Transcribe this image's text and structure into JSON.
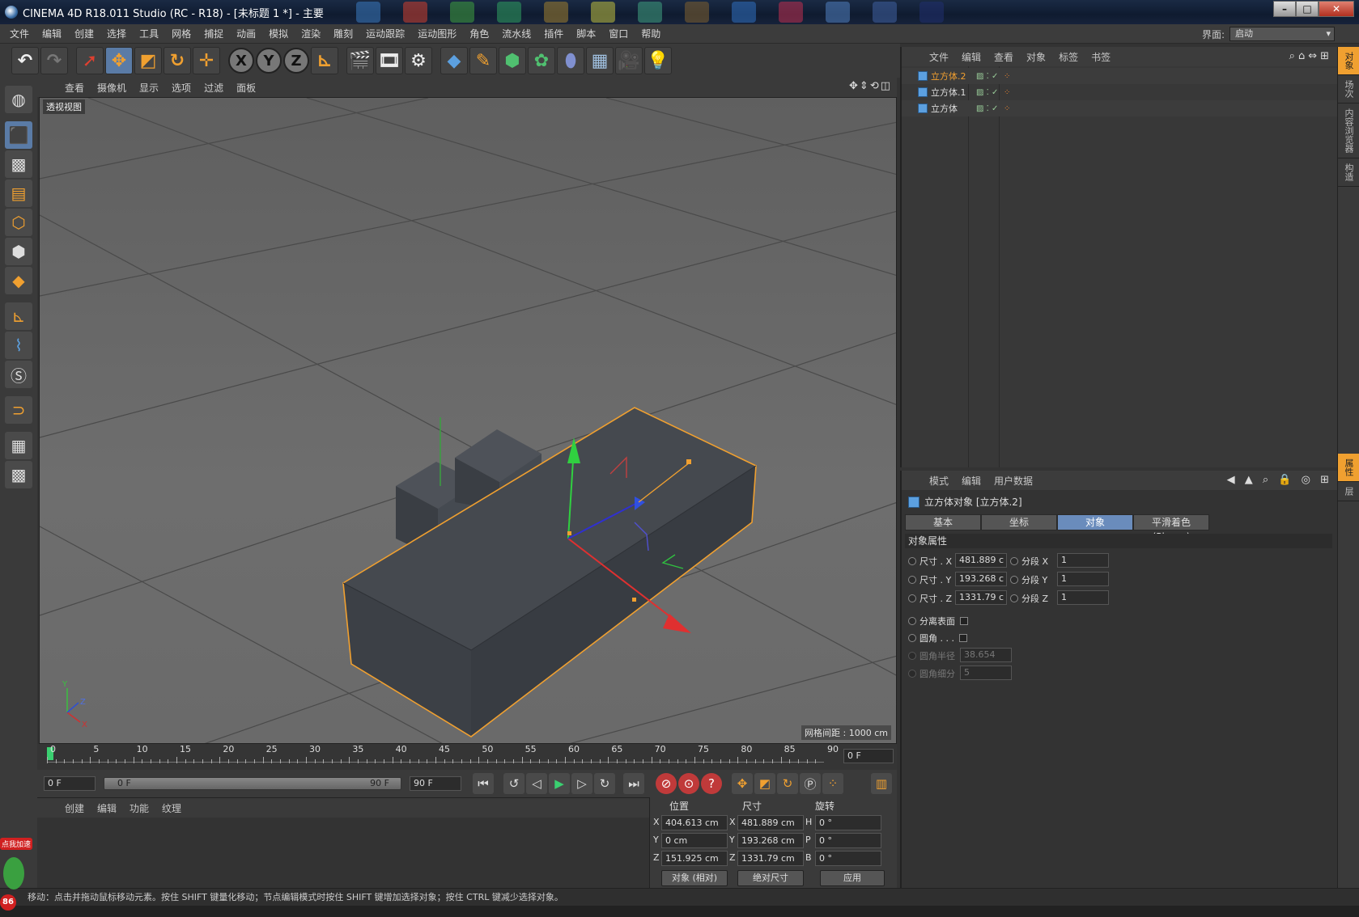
{
  "window": {
    "title": "CINEMA 4D R18.011 Studio (RC - R18) - [未标题 1 *] - 主要"
  },
  "menubar": {
    "items": [
      "文件",
      "编辑",
      "创建",
      "选择",
      "工具",
      "网格",
      "捕捉",
      "动画",
      "模拟",
      "渲染",
      "雕刻",
      "运动跟踪",
      "运动图形",
      "角色",
      "流水线",
      "插件",
      "脚本",
      "窗口",
      "帮助"
    ],
    "interface_label": "界面:",
    "interface_value": "启动"
  },
  "viewport": {
    "menu": [
      "查看",
      "摄像机",
      "显示",
      "选项",
      "过滤",
      "面板"
    ],
    "view_label": "透视视图",
    "grid_spacing": "网格间距 : 1000 cm",
    "axis_labels": {
      "y": "Y",
      "z": "Z",
      "x": "X"
    }
  },
  "timeline": {
    "ticks": [
      "0",
      "5",
      "10",
      "15",
      "20",
      "25",
      "30",
      "35",
      "40",
      "45",
      "50",
      "55",
      "60",
      "65",
      "70",
      "75",
      "80",
      "85",
      "90"
    ],
    "current_frame": "0 F"
  },
  "transport": {
    "start_field": "0 F",
    "range_start": "0 F",
    "range_end": "90 F",
    "end_field": "90 F"
  },
  "material_manager": {
    "menu": [
      "创建",
      "编辑",
      "功能",
      "纹理"
    ]
  },
  "coordinates": {
    "headers": {
      "position": "位置",
      "size": "尺寸",
      "rotation": "旋转"
    },
    "rows": [
      {
        "axis": "X",
        "pos": "404.613 cm",
        "size_axis": "X",
        "size": "481.889 cm",
        "rot_axis": "H",
        "rot": "0 °"
      },
      {
        "axis": "Y",
        "pos": "0 cm",
        "size_axis": "Y",
        "size": "193.268 cm",
        "rot_axis": "P",
        "rot": "0 °"
      },
      {
        "axis": "Z",
        "pos": "151.925 cm",
        "size_axis": "Z",
        "size": "1331.79 cm",
        "rot_axis": "B",
        "rot": "0 °"
      }
    ],
    "mode_select": "对象 (相对)",
    "size_select": "绝对尺寸",
    "apply_button": "应用"
  },
  "object_manager": {
    "menu": [
      "文件",
      "编辑",
      "查看",
      "对象",
      "标签",
      "书签"
    ],
    "objects": [
      {
        "name": "立方体.2",
        "selected": true
      },
      {
        "name": "立方体.1",
        "selected": false
      },
      {
        "name": "立方体",
        "selected": false
      }
    ]
  },
  "attribute_manager": {
    "menu": [
      "模式",
      "编辑",
      "用户数据"
    ],
    "object_title": "立方体对象 [立方体.2]",
    "tabs": [
      "基本",
      "坐标",
      "对象",
      "平滑着色(Phong)"
    ],
    "active_tab": "对象",
    "section": "对象属性",
    "size_x_label": "尺寸 . X",
    "size_x": "481.889 c",
    "size_y_label": "尺寸 . Y",
    "size_y": "193.268 c",
    "size_z_label": "尺寸 . Z",
    "size_z": "1331.79 c",
    "seg_x_label": "分段 X",
    "seg_x": "1",
    "seg_y_label": "分段 Y",
    "seg_y": "1",
    "seg_z_label": "分段 Z",
    "seg_z": "1",
    "separate_surfaces": "分离表面",
    "fillet": "圆角 . . .",
    "fillet_radius_label": "圆角半径",
    "fillet_radius": "38.654 cm",
    "fillet_subdiv_label": "圆角细分",
    "fillet_subdiv": "5"
  },
  "side_tabs": [
    "对象",
    "场次",
    "内容浏览器",
    "构造",
    "属性",
    "层"
  ],
  "status_bar": "移动：点击并拖动鼠标移动元素。按住 SHIFT 键量化移动；节点编辑模式时按住 SHIFT 键增加选择对象；按住 CTRL 键减少选择对象。",
  "badge": {
    "text": "点我加速",
    "count": "86"
  },
  "colors": {
    "accent": "#f0a030",
    "selection": "#6a8cbc",
    "panel": "#333333"
  }
}
